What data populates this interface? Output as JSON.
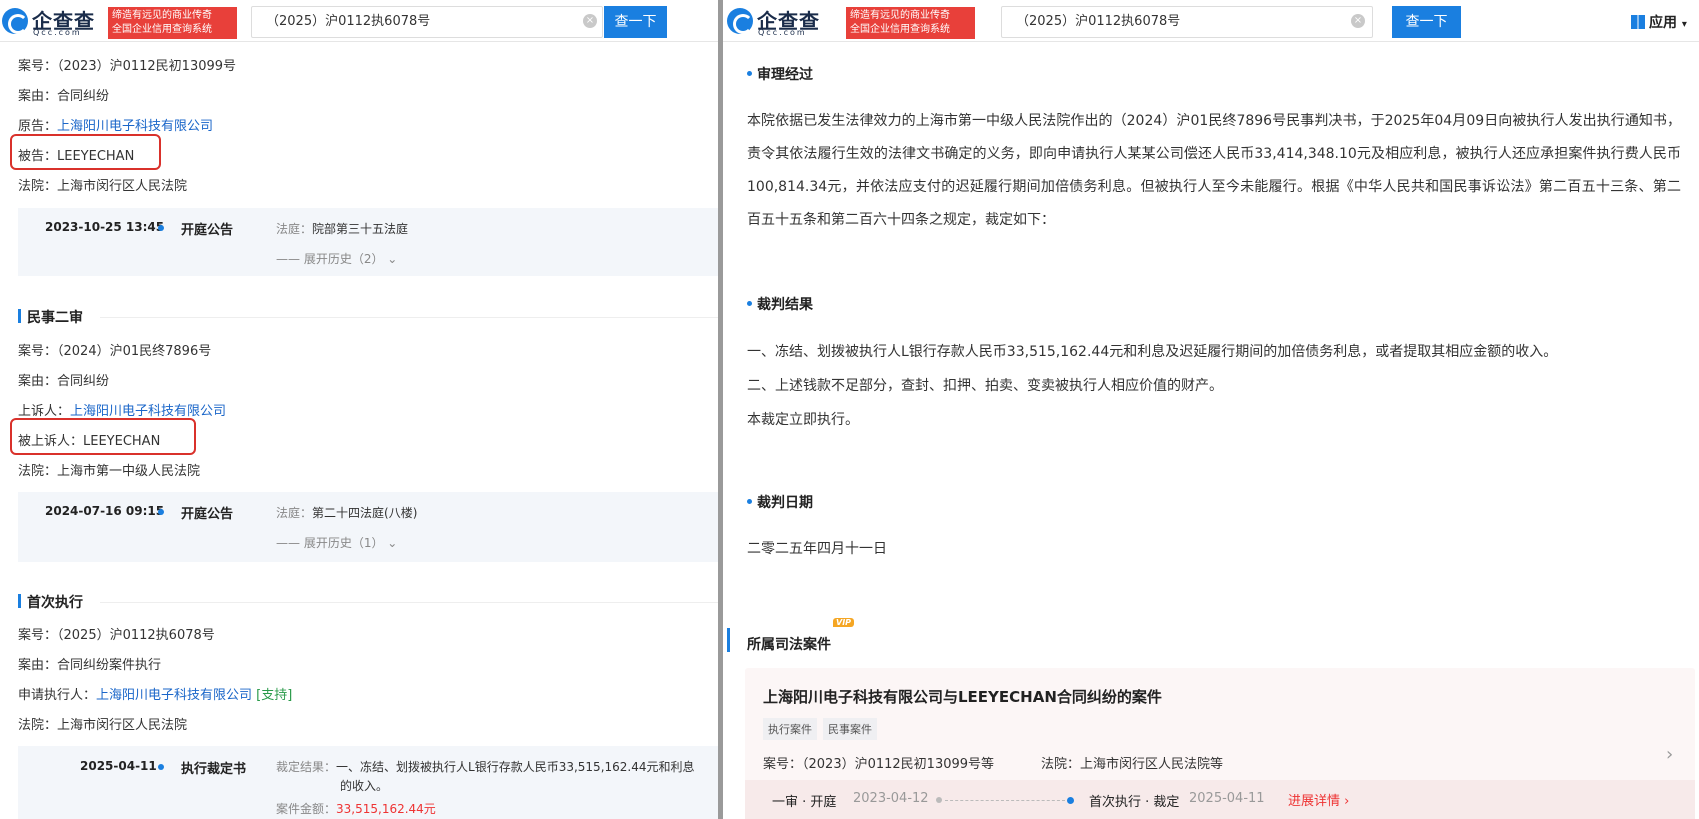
{
  "brand": {
    "logo_text": "企查查",
    "logo_sub": "Qcc.com",
    "slogan_1": "缔造有远见的商业传奇",
    "slogan_2": "全国企业信用查询系统"
  },
  "search": {
    "value": "（2025）沪0112执6078号",
    "button": "查一下"
  },
  "header_right": {
    "apps_label": "应用"
  },
  "left": {
    "s1": {
      "case_no": "案号：（2023）沪0112民初13099号",
      "cause": "案由：合同纠纷",
      "plaintiff_label": "原告：",
      "plaintiff": "上海阳川电子科技有限公司",
      "defendant": "被告：LEEYECHAN",
      "court": "法院：上海市闵行区人民法院",
      "tl_date": "2023-10-25 13:45",
      "tl_type": "开庭公告",
      "tl_detail_label": "法庭：",
      "tl_detail": "院部第三十五法庭",
      "tl_expand": "—— 展开历史（2）"
    },
    "s2": {
      "title": "民事二审",
      "case_no": "案号：（2024）沪01民终7896号",
      "cause": "案由：合同纠纷",
      "appellant_label": "上诉人：",
      "appellant": "上海阳川电子科技有限公司",
      "appellee": "被上诉人：LEEYECHAN",
      "court": "法院：上海市第一中级人民法院",
      "tl_date": "2024-07-16 09:15",
      "tl_type": "开庭公告",
      "tl_detail_label": "法庭：",
      "tl_detail": "第二十四法庭(八楼)",
      "tl_expand": "—— 展开历史（1）"
    },
    "s3": {
      "title": "首次执行",
      "case_no": "案号：（2025）沪0112执6078号",
      "cause": "案由：合同纠纷案件执行",
      "applicant_label": "申请执行人：",
      "applicant": "上海阳川电子科技有限公司",
      "applicant_tag": "[支持]",
      "court": "法院：上海市闵行区人民法院",
      "tl_date": "2025-04-11",
      "tl_type": "执行裁定书",
      "tl_detail_label": "裁定结果：",
      "tl_detail": "一、冻结、划拨被执行人L银行存款人民币33,515,162.44元和利息",
      "tl_detail_2": "的收入。",
      "tl_amount_label": "案件金额：",
      "tl_amount": "33,515,162.44元"
    }
  },
  "right": {
    "proc_title": "审理经过",
    "proc_text": "本院依据已发生法律效力的上海市第一中级人民法院作出的（2024）沪01民终7896号民事判决书，于2025年04月09日向被执行人发出执行通知书，责令其依法履行生效的法律文书确定的义务，即向申请执行人某某公司偿还人民币33,414,348.10元及相应利息，被执行人还应承担案件执行费人民币100,814.34元，并依法应支付的迟延履行期间加倍债务利息。但被执行人至今未能履行。根据《中华人民共和国民事诉讼法》第二百五十三条、第二百五十五条和第二百六十四条之规定，裁定如下：",
    "result_title": "裁判结果",
    "result_1": "一、冻结、划拨被执行人L银行存款人民币33,515,162.44元和利息及迟延履行期间的加倍债务利息，或者提取其相应金额的收入。",
    "result_2": "二、上述钱款不足部分，查封、扣押、拍卖、变卖被执行人相应价值的财产。",
    "result_3": "本裁定立即执行。",
    "date_title": "裁判日期",
    "date_text": "二零二五年四月十一日",
    "related_title": "所属司法案件",
    "vip": "VIP",
    "card": {
      "title": "上海阳川电子科技有限公司与LEEYECHAN合同纠纷的案件",
      "tag1": "执行案件",
      "tag2": "民事案件",
      "case_no": "案号：（2023）沪0112民初13099号等",
      "court": "法院：上海市闵行区人民法院等",
      "t1_label": "一审 · 开庭",
      "t1_date": "2023-04-12",
      "t2_label": "首次执行 · 裁定",
      "t2_date": "2025-04-11",
      "progress": "进展详情"
    }
  }
}
